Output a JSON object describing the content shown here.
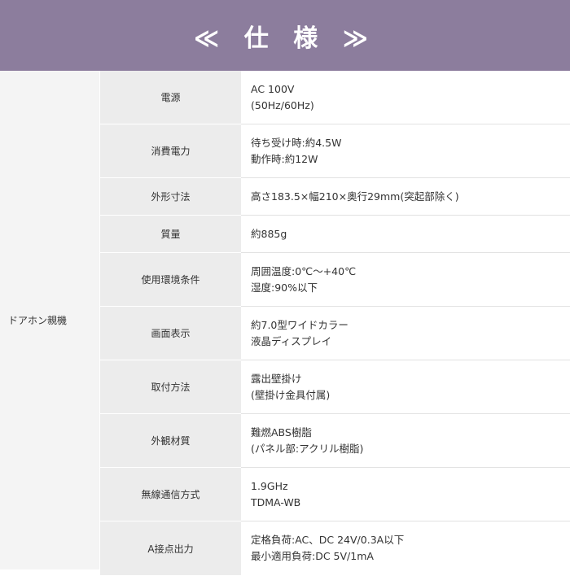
{
  "header": {
    "title": "≪ 仕 様 ≫"
  },
  "group_label": "ドアホン親機",
  "rows": [
    {
      "label": "電源",
      "lines": [
        "AC 100V",
        "(50Hz/60Hz)"
      ]
    },
    {
      "label": "消費電力",
      "lines": [
        "待ち受け時:約4.5W",
        "動作時:約12W"
      ]
    },
    {
      "label": "外形寸法",
      "lines": [
        "高さ183.5×幅210×奥行29mm(突起部除く)"
      ]
    },
    {
      "label": "質量",
      "lines": [
        "約885g"
      ]
    },
    {
      "label": "使用環境条件",
      "lines": [
        "周囲温度:0℃～+40℃",
        "湿度:90%以下"
      ]
    },
    {
      "label": "画面表示",
      "lines": [
        "約7.0型ワイドカラー",
        "液晶ディスプレイ"
      ]
    },
    {
      "label": "取付方法",
      "lines": [
        "露出壁掛け",
        "(壁掛け金具付属)"
      ]
    },
    {
      "label": "外観材質",
      "lines": [
        "難燃ABS樹脂",
        "(パネル部:アクリル樹脂)"
      ]
    },
    {
      "label": "無線通信方式",
      "lines": [
        "1.9GHz",
        "TDMA-WB"
      ]
    },
    {
      "label": "A接点出力",
      "lines": [
        "定格負荷:AC、DC 24V/0.3A以下",
        "最小適用負荷:DC 5V/1mA"
      ]
    }
  ]
}
